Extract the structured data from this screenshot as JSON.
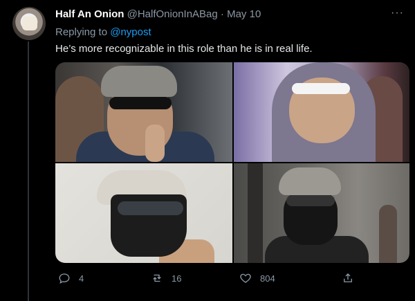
{
  "tweet": {
    "display_name": "Half An Onion",
    "handle": "@HalfOnionInABag",
    "separator": "·",
    "date": "May 10",
    "more_label": "···",
    "replying_prefix": "Replying to",
    "replying_to": "@nypost",
    "text": "He’s more recognizable in this role than he is in real life.",
    "photos": [
      "photo-1",
      "photo-2",
      "photo-3",
      "photo-4"
    ]
  },
  "actions": {
    "reply_count": "4",
    "retweet_count": "16",
    "like_count": "804",
    "icons": [
      "reply-icon",
      "retweet-icon",
      "like-icon",
      "share-icon"
    ]
  },
  "colors": {
    "background": "#000000",
    "link": "#1d9bf0",
    "muted": "#8b98a5",
    "text": "#e7e9ea"
  }
}
